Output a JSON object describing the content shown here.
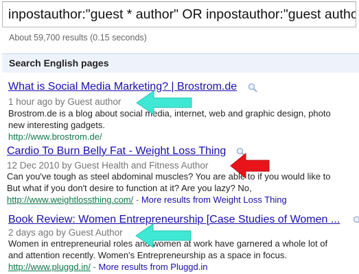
{
  "search": {
    "query": "inpostauthor:\"guest * author\" OR inpostauthor:\"guest author\""
  },
  "stats": "About 59,700 results (0.15 seconds)",
  "section_header": "Search English pages",
  "results": [
    {
      "title": "What is Social Media Marketing? | Brostrom.de",
      "meta": "1 hour ago by Guest author",
      "snippet": [
        "Brostrom.de is a blog about social media, internet, web and graphic design, photo",
        "new interesting gadgets."
      ],
      "url": "http://www.brostrom.de/",
      "more": ""
    },
    {
      "title": "Cardio To Burn Belly Fat - Weight Loss Thing",
      "meta": "12 Dec 2010 by Guest Health and Fitness Author",
      "snippet": [
        "Can you've tough as steel abdominal muscles? You are able to if you would like to",
        "But what if you don't desire to function at it? Are you lazy? No,"
      ],
      "url": "http://www.weightlossthing.com/",
      "more": "More results from Weight Loss Thing"
    },
    {
      "title": "Book Review: Women Entrepreneurship [Case Studies of Women ...",
      "meta": "2 days ago by Guest Author",
      "snippet": [
        "Women in entrepreneurial roles and women at work have garnered a whole lot of",
        "and attention recently. Women's Entrepreneurship as a space in focus."
      ],
      "url": "http://www.pluggd.in/",
      "more": "More results from Pluggd.in"
    }
  ],
  "separator": " - ",
  "colors": {
    "arrow_cyan": "#3fe8d4",
    "arrow_red": "#e8141a",
    "link": "#1a0dab",
    "url_green": "#0e774a",
    "meta_gray": "#767676"
  },
  "icons": {
    "magnifier": "magnifier-icon",
    "arrow": "arrow-icon"
  }
}
